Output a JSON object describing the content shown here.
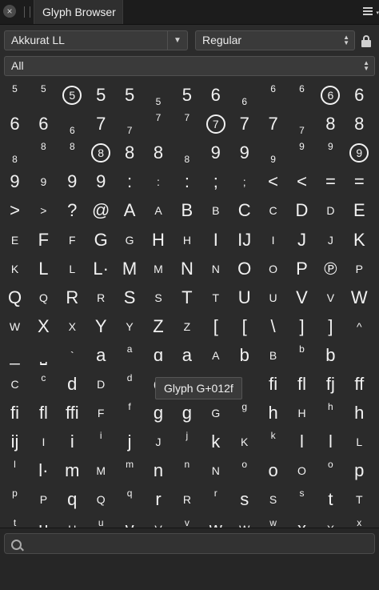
{
  "panel": {
    "close_glyph": "×",
    "title": "Glyph Browser"
  },
  "font_select": {
    "value": "Akkurat LL",
    "arrow": "▼"
  },
  "style_select": {
    "value": "Regular",
    "stepper_up": "▲",
    "stepper_down": "▼"
  },
  "category_select": {
    "value": "All"
  },
  "tooltip": {
    "text": "Glyph G+012f"
  },
  "search": {
    "placeholder": ""
  },
  "glyph_rows": [
    [
      [
        "5",
        "sup"
      ],
      [
        "5",
        "sup"
      ],
      [
        "5",
        "circ"
      ],
      [
        "5",
        "big"
      ],
      [
        "5",
        "big"
      ],
      [
        "5",
        "sub"
      ],
      [
        "5",
        "big"
      ],
      [
        "6",
        "big"
      ],
      [
        "6",
        "sub"
      ],
      [
        "6",
        "sup"
      ],
      [
        "6",
        "sup"
      ],
      [
        "6",
        "circ"
      ],
      [
        "6",
        "big"
      ]
    ],
    [
      [
        "6",
        "big"
      ],
      [
        "6",
        "big"
      ],
      [
        "6",
        "sub"
      ],
      [
        "7",
        "big"
      ],
      [
        "7",
        "sub"
      ],
      [
        "7",
        "sup"
      ],
      [
        "7",
        "sup"
      ],
      [
        "7",
        "circ"
      ],
      [
        "7",
        "big"
      ],
      [
        "7",
        "big"
      ],
      [
        "7",
        "sub"
      ],
      [
        "8",
        "big"
      ],
      [
        "8",
        "big"
      ]
    ],
    [
      [
        "8",
        "sub"
      ],
      [
        "8",
        "sup"
      ],
      [
        "8",
        "sup"
      ],
      [
        "8",
        "circ"
      ],
      [
        "8",
        "big"
      ],
      [
        "8",
        "big"
      ],
      [
        "8",
        "sub"
      ],
      [
        "9",
        "big"
      ],
      [
        "9",
        "big"
      ],
      [
        "9",
        "sub"
      ],
      [
        "9",
        "sup"
      ],
      [
        "9",
        "sup"
      ],
      [
        "9",
        "circ"
      ]
    ],
    [
      [
        "9",
        "big"
      ],
      [
        "9",
        "small"
      ],
      [
        "9",
        "big"
      ],
      [
        "9",
        "big"
      ],
      [
        ":",
        "big"
      ],
      [
        ":",
        "small"
      ],
      [
        ":",
        "big"
      ],
      [
        ";",
        "big"
      ],
      [
        ";",
        "small"
      ],
      [
        "<",
        "big"
      ],
      [
        "<",
        "big"
      ],
      [
        "=",
        "big"
      ],
      [
        "=",
        "big"
      ]
    ],
    [
      [
        ">",
        "big"
      ],
      [
        ">",
        "small"
      ],
      [
        "?",
        "big"
      ],
      [
        "@",
        "big"
      ],
      [
        "A",
        "big"
      ],
      [
        "A",
        "small"
      ],
      [
        "B",
        "big"
      ],
      [
        "B",
        "small"
      ],
      [
        "C",
        "big"
      ],
      [
        "C",
        "small"
      ],
      [
        "D",
        "big"
      ],
      [
        "D",
        "small"
      ],
      [
        "E",
        "big"
      ]
    ],
    [
      [
        "E",
        "small"
      ],
      [
        "F",
        "big"
      ],
      [
        "F",
        "small"
      ],
      [
        "G",
        "big"
      ],
      [
        "G",
        "small"
      ],
      [
        "H",
        "big"
      ],
      [
        "H",
        "small"
      ],
      [
        "I",
        "big"
      ],
      [
        "IJ",
        "big"
      ],
      [
        "I",
        "small"
      ],
      [
        "J",
        "big"
      ],
      [
        "J",
        "small"
      ],
      [
        "K",
        "big"
      ]
    ],
    [
      [
        "K",
        "small"
      ],
      [
        "L",
        "big"
      ],
      [
        "L",
        "small"
      ],
      [
        "L·",
        "big"
      ],
      [
        "M",
        "big"
      ],
      [
        "M",
        "small"
      ],
      [
        "N",
        "big"
      ],
      [
        "N",
        "small"
      ],
      [
        "O",
        "big"
      ],
      [
        "O",
        "small"
      ],
      [
        "P",
        "big"
      ],
      [
        "℗",
        "big"
      ],
      [
        "P",
        "small"
      ]
    ],
    [
      [
        "Q",
        "big"
      ],
      [
        "Q",
        "small"
      ],
      [
        "R",
        "big"
      ],
      [
        "R",
        "small"
      ],
      [
        "S",
        "big"
      ],
      [
        "S",
        "small"
      ],
      [
        "T",
        "big"
      ],
      [
        "T",
        "small"
      ],
      [
        "U",
        "big"
      ],
      [
        "U",
        "small"
      ],
      [
        "V",
        "big"
      ],
      [
        "V",
        "small"
      ],
      [
        "W",
        "big"
      ]
    ],
    [
      [
        "W",
        "small"
      ],
      [
        "X",
        "big"
      ],
      [
        "X",
        "small"
      ],
      [
        "Y",
        "big"
      ],
      [
        "Y",
        "small"
      ],
      [
        "Z",
        "big"
      ],
      [
        "Z",
        "small"
      ],
      [
        "[",
        "big"
      ],
      [
        "[",
        "big"
      ],
      [
        "\\",
        "big"
      ],
      [
        "]",
        "big"
      ],
      [
        "]",
        "big"
      ],
      [
        "^",
        "small"
      ]
    ],
    [
      [
        "_",
        "big"
      ],
      [
        "⎵",
        "big"
      ],
      [
        "`",
        "small"
      ],
      [
        "a",
        "big"
      ],
      [
        "a",
        "sup"
      ],
      [
        "ɑ",
        "big"
      ],
      [
        "a",
        "big"
      ],
      [
        "A",
        "small"
      ],
      [
        "b",
        "big"
      ],
      [
        "B",
        "small"
      ],
      [
        "b",
        "sup"
      ],
      [
        "b",
        "big"
      ],
      [
        "",
        ""
      ]
    ],
    [
      [
        "C",
        "small"
      ],
      [
        "c",
        "sup"
      ],
      [
        "d",
        "big"
      ],
      [
        "D",
        "small"
      ],
      [
        "d",
        "sup"
      ],
      [
        "e",
        "big"
      ],
      [
        "",
        ""
      ],
      [
        "",
        ""
      ],
      [
        "",
        ""
      ],
      [
        "fi",
        "big"
      ],
      [
        "fl",
        "big"
      ],
      [
        "fj",
        "big"
      ],
      [
        "ff",
        "big"
      ]
    ],
    [
      [
        "fi",
        "big"
      ],
      [
        "fl",
        "big"
      ],
      [
        "ffi",
        "big"
      ],
      [
        "F",
        "small"
      ],
      [
        "f",
        "sup"
      ],
      [
        "g",
        "big"
      ],
      [
        "g",
        "big"
      ],
      [
        "G",
        "small"
      ],
      [
        "g",
        "sup"
      ],
      [
        "h",
        "big"
      ],
      [
        "H",
        "small"
      ],
      [
        "h",
        "sup"
      ],
      [
        "h",
        "big"
      ]
    ],
    [
      [
        "ij",
        "big"
      ],
      [
        "I",
        "small"
      ],
      [
        "i",
        "big"
      ],
      [
        "i",
        "sup"
      ],
      [
        "j",
        "big"
      ],
      [
        "J",
        "small"
      ],
      [
        "j",
        "sup"
      ],
      [
        "k",
        "big"
      ],
      [
        "K",
        "small"
      ],
      [
        "k",
        "sup"
      ],
      [
        "l",
        "big"
      ],
      [
        "l",
        "big"
      ],
      [
        "L",
        "small"
      ]
    ],
    [
      [
        "l",
        "sup"
      ],
      [
        "l·",
        "big"
      ],
      [
        "m",
        "big"
      ],
      [
        "M",
        "small"
      ],
      [
        "m",
        "sup"
      ],
      [
        "n",
        "big"
      ],
      [
        "n",
        "sup"
      ],
      [
        "N",
        "small"
      ],
      [
        "o",
        "sup"
      ],
      [
        "o",
        "big"
      ],
      [
        "O",
        "small"
      ],
      [
        "o",
        "sup"
      ],
      [
        "p",
        "big"
      ]
    ],
    [
      [
        "p",
        "sup"
      ],
      [
        "P",
        "small"
      ],
      [
        "q",
        "big"
      ],
      [
        "Q",
        "small"
      ],
      [
        "q",
        "sup"
      ],
      [
        "r",
        "big"
      ],
      [
        "R",
        "small"
      ],
      [
        "r",
        "sup"
      ],
      [
        "s",
        "big"
      ],
      [
        "S",
        "small"
      ],
      [
        "s",
        "sup"
      ],
      [
        "t",
        "big"
      ],
      [
        "T",
        "small"
      ]
    ],
    [
      [
        "t",
        "sup"
      ],
      [
        "u",
        "big"
      ],
      [
        "U",
        "small"
      ],
      [
        "u",
        "sup"
      ],
      [
        "v",
        "big"
      ],
      [
        "V",
        "small"
      ],
      [
        "v",
        "sup"
      ],
      [
        "w",
        "big"
      ],
      [
        "W",
        "small"
      ],
      [
        "w",
        "sup"
      ],
      [
        "x",
        "big"
      ],
      [
        "X",
        "small"
      ],
      [
        "x",
        "sup"
      ]
    ]
  ]
}
